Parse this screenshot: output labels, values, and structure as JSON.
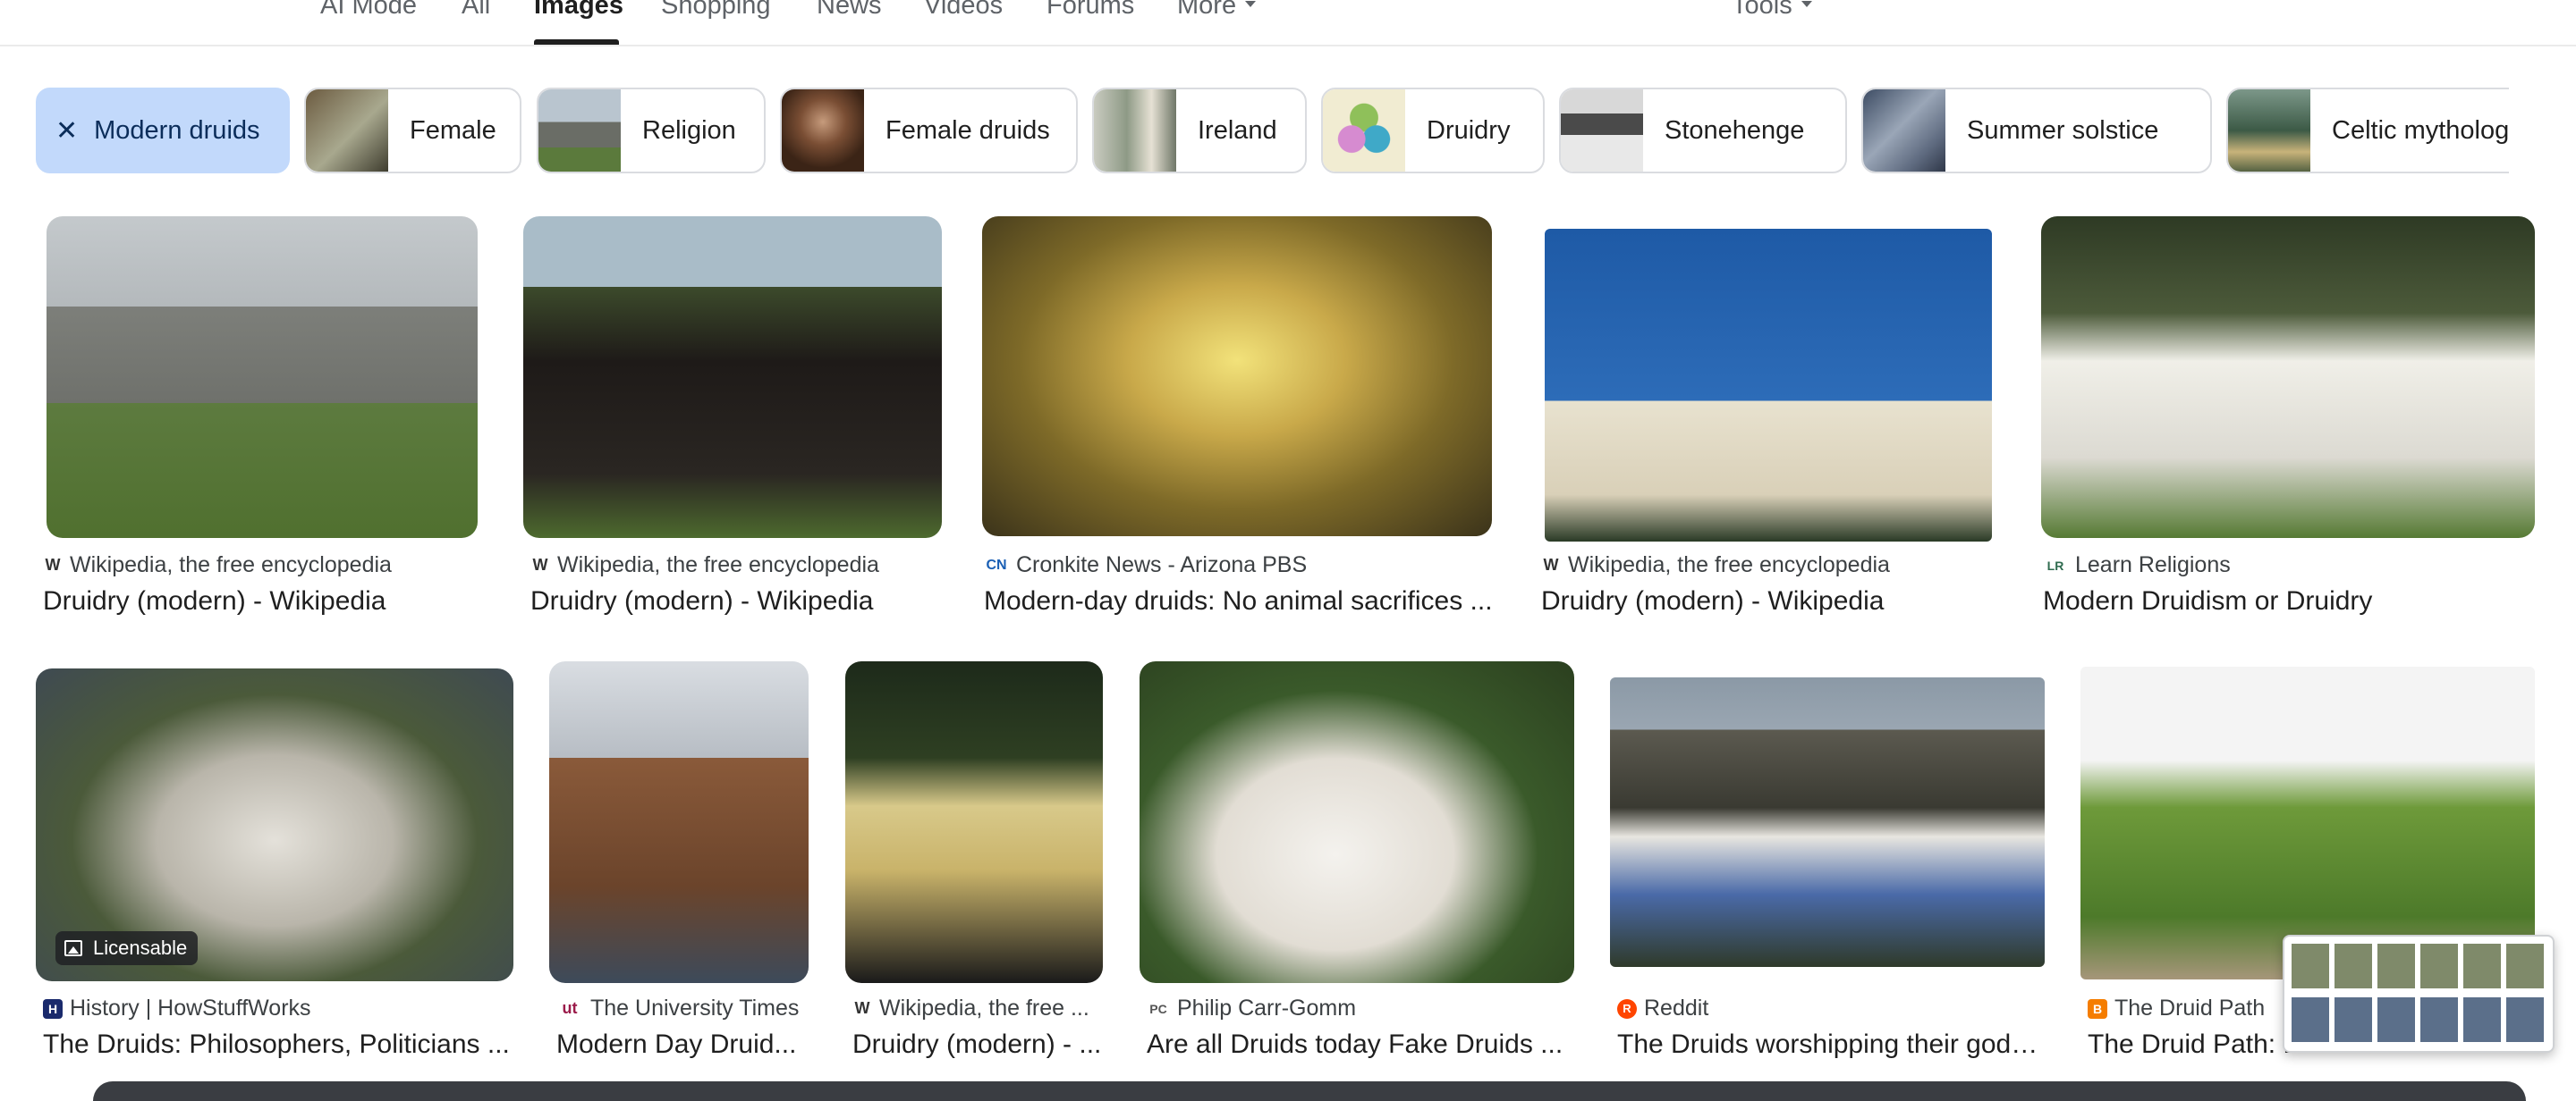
{
  "tabs": [
    {
      "label": "AI Mode",
      "active": false
    },
    {
      "label": "All",
      "active": false
    },
    {
      "label": "Images",
      "active": true
    },
    {
      "label": "Shopping",
      "active": false
    },
    {
      "label": "News",
      "active": false
    },
    {
      "label": "Videos",
      "active": false
    },
    {
      "label": "Forums",
      "active": false
    },
    {
      "label": "More",
      "active": false
    }
  ],
  "tools_label": "Tools",
  "chips": {
    "selected": {
      "label": "Modern druids",
      "close_glyph": "✕"
    },
    "items": [
      {
        "label": "Female"
      },
      {
        "label": "Religion"
      },
      {
        "label": "Female druids"
      },
      {
        "label": "Ireland"
      },
      {
        "label": "Druidry"
      },
      {
        "label": "Stonehenge"
      },
      {
        "label": "Summer solstice"
      },
      {
        "label": "Celtic mythology"
      }
    ]
  },
  "results": [
    {
      "source": "Wikipedia, the free encyclopedia",
      "title": "Druidry (modern) - Wikipedia",
      "favicon": "W"
    },
    {
      "source": "Wikipedia, the free encyclopedia",
      "title": "Druidry (modern) - Wikipedia",
      "favicon": "W"
    },
    {
      "source": "Cronkite News - Arizona PBS",
      "title": "Modern-day druids: No animal sacrifices ...",
      "favicon": "CN"
    },
    {
      "source": "Wikipedia, the free encyclopedia",
      "title": "Druidry (modern) - Wikipedia",
      "favicon": "W"
    },
    {
      "source": "Learn Religions",
      "title": "Modern Druidism or Druidry",
      "favicon": "LR"
    },
    {
      "source": "History | HowStuffWorks",
      "title": "The Druids: Philosophers, Politicians ...",
      "favicon": "H",
      "badge": "Licensable"
    },
    {
      "source": "The University Times",
      "title": "Modern Day Druid...",
      "favicon": "ut"
    },
    {
      "source": "Wikipedia, the free ...",
      "title": "Druidry (modern) - ...",
      "favicon": "W"
    },
    {
      "source": "Philip Carr-Gomm",
      "title": "Are all Druids today Fake Druids ...",
      "favicon": "PC"
    },
    {
      "source": "Reddit",
      "title": "The Druids worshipping their gods...",
      "favicon": "R"
    },
    {
      "source": "The Druid Path",
      "title": "The Druid Path: D...",
      "favicon": "B"
    }
  ],
  "colors": {
    "chip_selected_bg": "#c2d9fb",
    "chip_selected_text": "#0b2d5a",
    "reddit": "#ff4500",
    "blogger": "#f57d00",
    "univ_times": "#9b1b4a"
  }
}
